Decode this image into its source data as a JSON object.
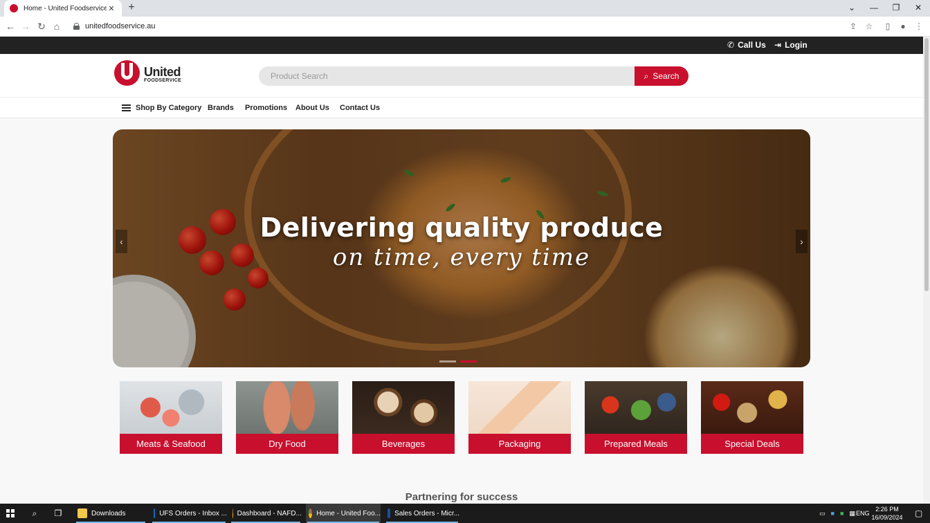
{
  "browser": {
    "tab_title": "Home - United Foodservice",
    "url": "unitedfoodservice.au",
    "new_tab": "+",
    "close_tab": "✕"
  },
  "site": {
    "topbar": {
      "call_us": "Call Us",
      "login": "Login"
    },
    "logo": {
      "name": "United",
      "sub": "FOODSERVICE"
    },
    "search": {
      "placeholder": "Product Search",
      "button": "Search"
    },
    "nav": {
      "shop_by_category": "Shop By Category",
      "brands": "Brands",
      "promotions": "Promotions",
      "about_us": "About Us",
      "contact_us": "Contact Us"
    },
    "hero": {
      "headline": "Delivering quality produce",
      "tagline": "on time, every time",
      "prev": "‹",
      "next": "›"
    },
    "categories": [
      {
        "label": "Meats & Seafood"
      },
      {
        "label": "Dry Food"
      },
      {
        "label": "Beverages"
      },
      {
        "label": "Packaging"
      },
      {
        "label": "Prepared Meals"
      },
      {
        "label": "Special Deals"
      }
    ],
    "section_heading": "Partnering for success"
  },
  "taskbar": {
    "apps": [
      {
        "label": "Downloads",
        "icon": "folder-icon"
      },
      {
        "label": "UFS Orders - Inbox ...",
        "icon": "outlook-icon"
      },
      {
        "label": "Dashboard - NAFD...",
        "icon": "chrome-icon"
      },
      {
        "label": "Home - United Foo...",
        "icon": "chrome-icon"
      },
      {
        "label": "Sales Orders - Micr...",
        "icon": "dynamics-icon"
      }
    ],
    "language": "ENG",
    "time": "2:26 PM",
    "date": "16/09/2024"
  },
  "colors": {
    "brand_red": "#c8102e",
    "topbar": "#222222"
  }
}
